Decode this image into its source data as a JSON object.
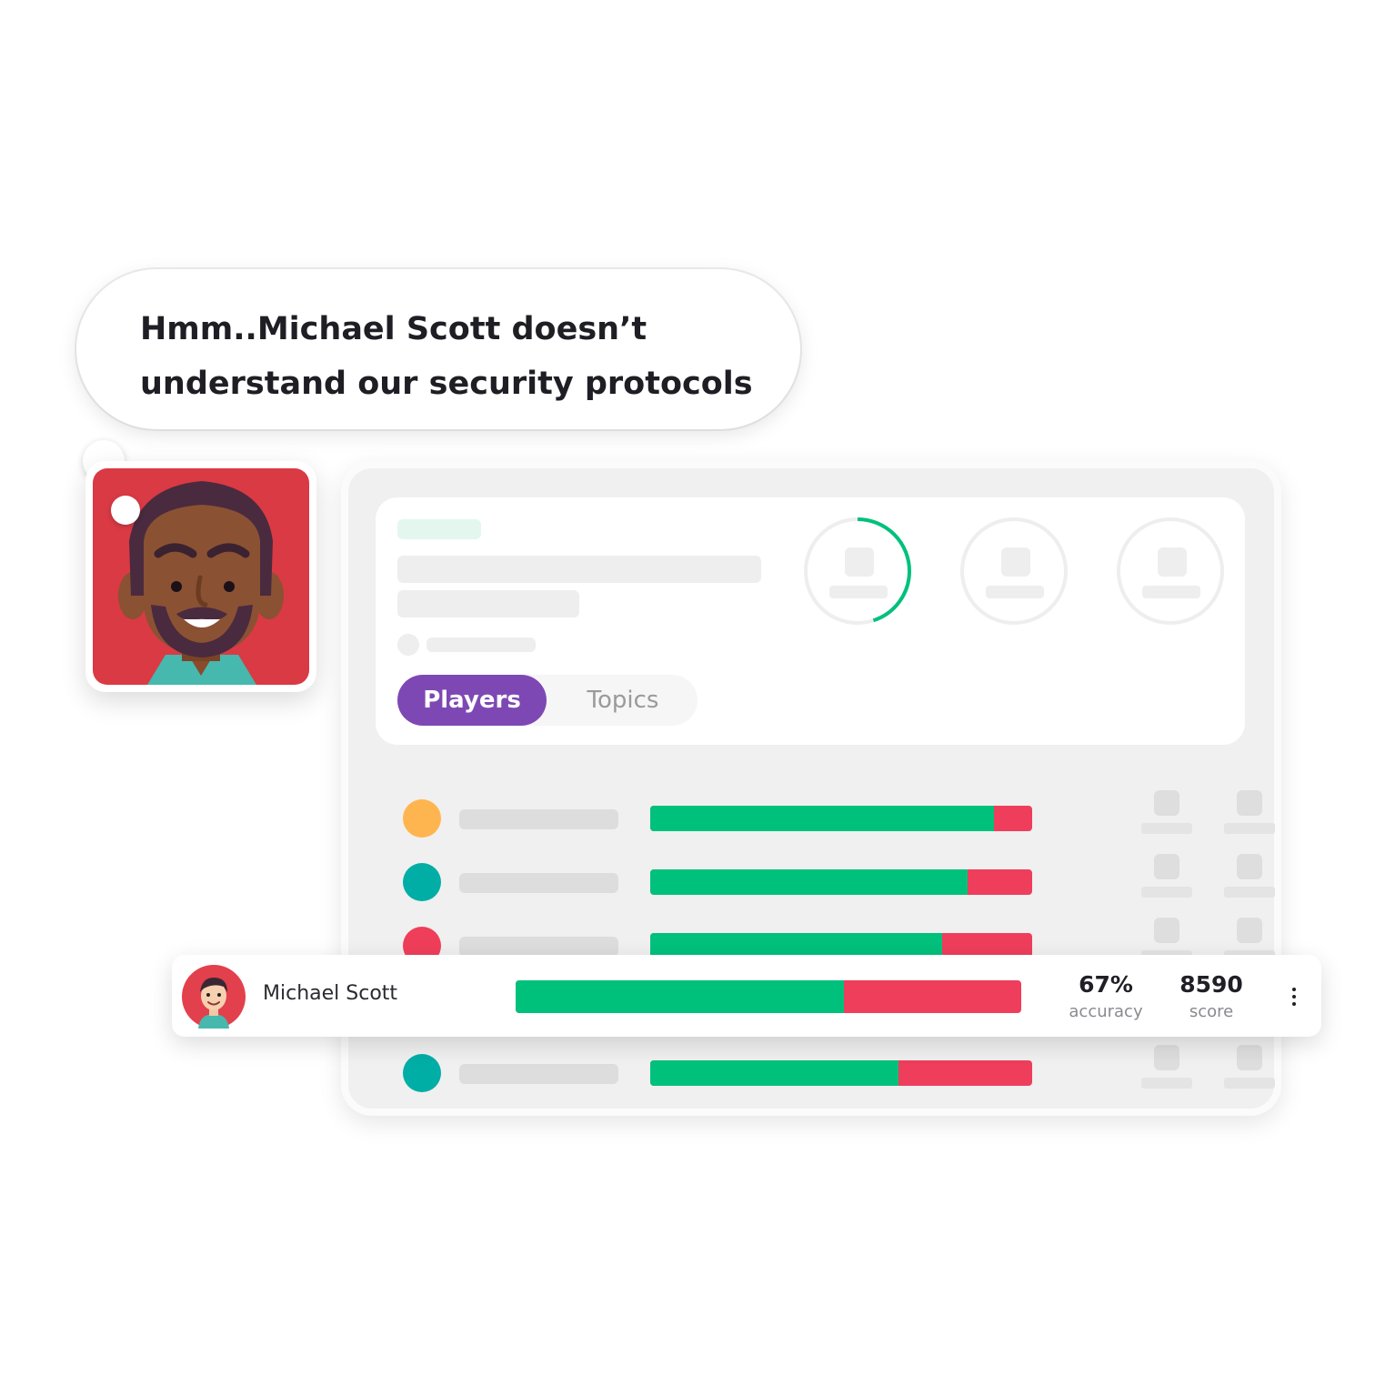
{
  "speech": {
    "line1": "Hmm..Michael Scott doesn’t",
    "line2": "understand our security protocols"
  },
  "tabs": [
    {
      "label": "Players",
      "active": true
    },
    {
      "label": "Topics",
      "active": false
    }
  ],
  "progress_ring": {
    "fraction": 0.45,
    "color": "#00c17c"
  },
  "rows": [
    {
      "dot_color": "#ffb54f",
      "accuracy_fraction": 0.9
    },
    {
      "dot_color": "#00aea6",
      "accuracy_fraction": 0.83
    },
    {
      "dot_color": "#ef3e5a",
      "accuracy_fraction": 0.765
    },
    {
      "dot_color": "#00aea6",
      "accuracy_fraction": 0.65
    }
  ],
  "highlight": {
    "name": "Michael Scott",
    "accuracy_fraction": 0.65,
    "accuracy_value": "67%",
    "accuracy_label": "accuracy",
    "score_value": "8590",
    "score_label": "score"
  },
  "colors": {
    "accent_purple": "#7e48b4",
    "correct_green": "#00c17c",
    "wrong_red": "#ee3e5c",
    "avatar_bg": "#d93a44"
  },
  "icons": {
    "menu": "kebab-menu-icon",
    "avatar": "bearded-man-avatar",
    "small_avatar": "michael-scott-avatar"
  }
}
